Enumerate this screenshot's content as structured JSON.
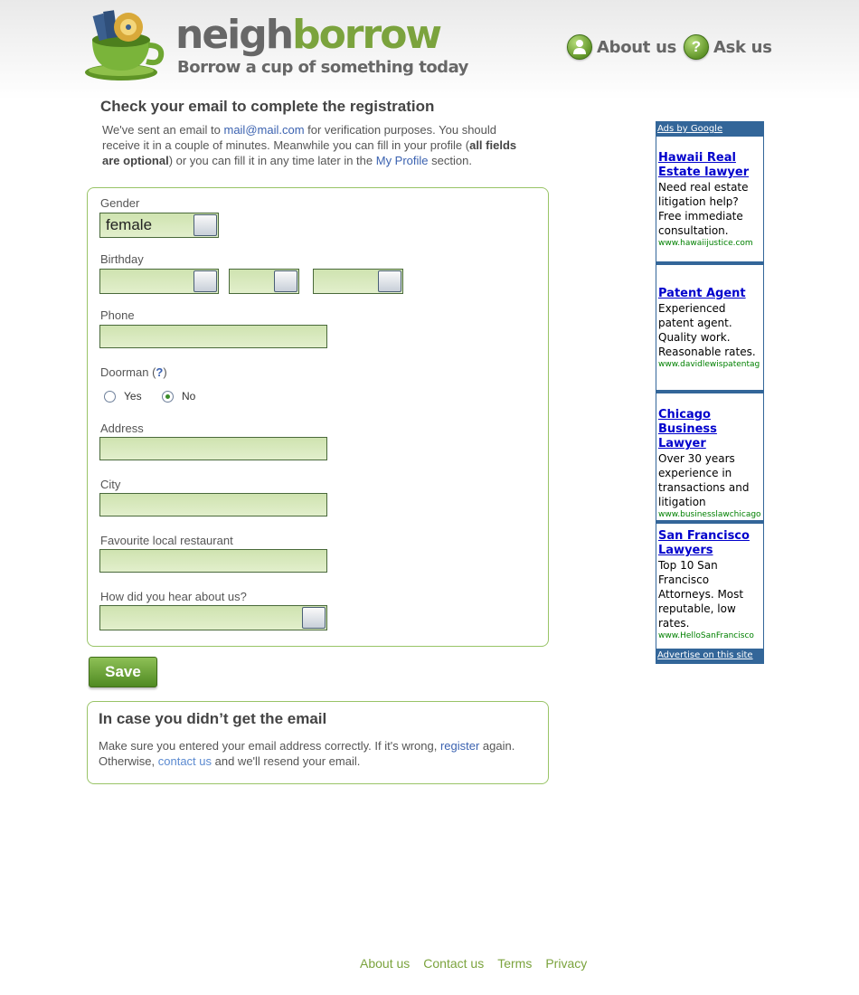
{
  "brand": {
    "wordmark_dark": "neigh",
    "wordmark_green": "borrow",
    "tagline": "Borrow a cup of something today"
  },
  "topnav": [
    {
      "label": "About us",
      "icon": "person-icon"
    },
    {
      "label": "Ask us",
      "icon": "question-icon"
    }
  ],
  "page_title": "Check your email to complete the registration",
  "intro": {
    "p1": "We've sent an email to ",
    "email": "mail@mail.com",
    "p2": " for verification purposes. You should receive it in a couple of minutes. Meanwhile you can fill in your profile (",
    "bold": "all fields are optional",
    "p3": ") or you can fill it in any time later in the ",
    "profile_link": "My Profile",
    "p4": " section."
  },
  "form": {
    "gender_label": "Gender",
    "gender_value": "female",
    "birthday_label": "Birthday",
    "phone_label": "Phone",
    "doorman_label": "Doorman (",
    "doorman_help": "?",
    "doorman_close": ")",
    "doorman_yes": "Yes",
    "doorman_no": "No",
    "doorman_selected": "No",
    "address_label": "Address",
    "city_label": "City",
    "restaurant_label": "Favourite local restaurant",
    "hear_label": "How did you hear about us?"
  },
  "save_label": "Save",
  "email_help": {
    "title": "In case you didn’t get the email",
    "t1": "Make sure you entered your email address correctly. If it's wrong, ",
    "register_link": "register",
    "t2": " again. Otherwise, ",
    "contact_link": "contact us",
    "t3": " and we'll resend your email."
  },
  "ads": {
    "header": "Ads by Google",
    "footer": "Advertise on this site",
    "items": [
      {
        "title": "Hawaii Real Estate lawyer",
        "desc": "Need real estate litigation help? Free immediate consultation.",
        "url": "www.hawaiijustice.com"
      },
      {
        "title": "Patent Agent",
        "desc": "Experienced patent agent. Quality work. Reasonable rates.",
        "url": "www.davidlewispatentag"
      },
      {
        "title": "Chicago Business Lawyer",
        "desc": "Over 30 years experience in transactions and litigation",
        "url": "www.businesslawchicago"
      },
      {
        "title": "San Francisco Lawyers",
        "desc": "Top 10 San Francisco Attorneys. Most reputable, low rates.",
        "url": "www.HelloSanFrancisco"
      }
    ]
  },
  "footer": [
    "About us",
    "Contact us",
    "Terms",
    "Privacy"
  ],
  "colors": {
    "brand_green": "#7ba33d",
    "link_blue": "#3b62b0",
    "ad_blue": "#336699"
  }
}
